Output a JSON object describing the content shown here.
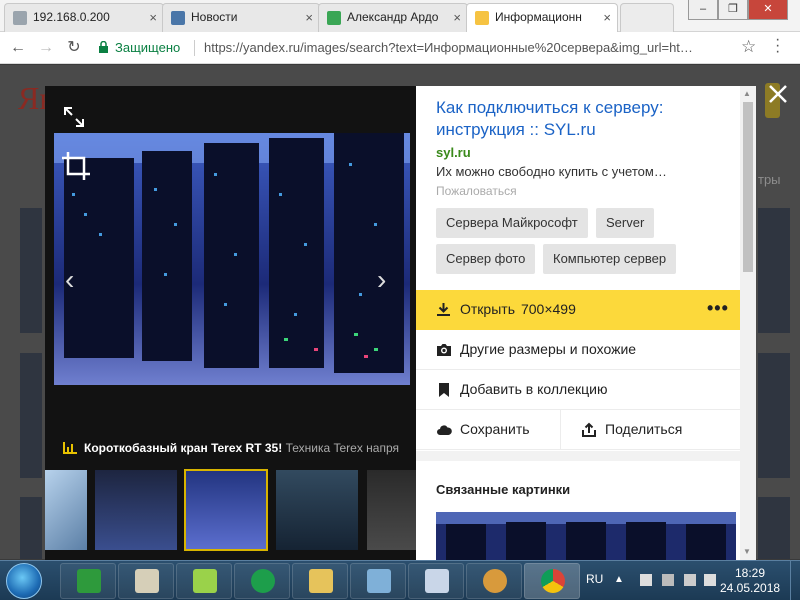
{
  "browser": {
    "tabs": [
      {
        "label": "192.168.0.200"
      },
      {
        "label": "Новости"
      },
      {
        "label": "Александр Ардо"
      },
      {
        "label": "Информационн"
      }
    ],
    "secure_label": "Защищено",
    "url": "https://yandex.ru/images/search?text=Информационные%20сервера&img_url=ht…"
  },
  "page": {
    "logo": "Ян",
    "right_word": "тры"
  },
  "viewer": {
    "caption_title": "Короткобазный кран Terex RT 35!",
    "caption_sub": "Техника Terex напря"
  },
  "panel": {
    "title": "Как подключиться к серверу: инструкция :: SYL.ru",
    "domain": "syl.ru",
    "description": "Их можно свободно купить с учетом…",
    "complain": "Пожаловаться",
    "tags": [
      "Сервера Майкрософт",
      "Server",
      "Сервер фото",
      "Компьютер сервер"
    ],
    "open_label": "Открыть",
    "open_dims": "700×499",
    "more_label": "•••",
    "other_sizes": "Другие размеры и похожие",
    "add_collection": "Добавить в коллекцию",
    "save": "Сохранить",
    "share": "Поделиться",
    "related_title": "Связанные картинки"
  },
  "taskbar": {
    "lang": "RU",
    "time": "18:29",
    "date": "24.05.2018"
  },
  "colors": {
    "accent_yellow": "#fcd93b",
    "link_blue": "#1b63c6",
    "domain_green": "#3a8a1b",
    "secure_green": "#0b8043"
  }
}
